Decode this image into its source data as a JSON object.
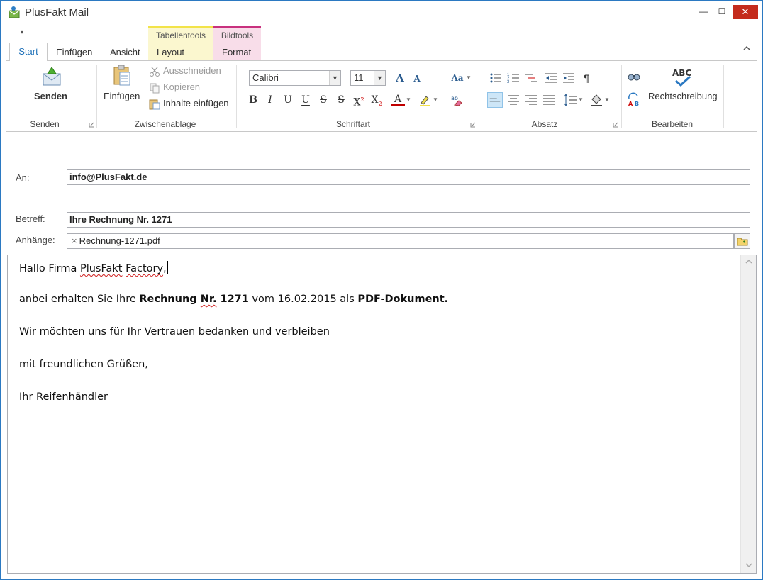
{
  "window": {
    "title": "PlusFakt Mail",
    "min_glyph": "—",
    "max_glyph": "☐",
    "close_glyph": "✕"
  },
  "qat": {
    "dropdown_glyph": "▾"
  },
  "tabs": {
    "start": "Start",
    "einfuegen": "Einfügen",
    "ansicht": "Ansicht",
    "layout": "Layout",
    "format": "Format",
    "ctx_tabellentools": "Tabellentools",
    "ctx_bildtools": "Bildtools"
  },
  "ribbon": {
    "senden": {
      "button": "Senden",
      "group": "Senden"
    },
    "zwischenablage": {
      "einfuegen": "Einfügen",
      "ausschneiden": "Ausschneiden",
      "kopieren": "Kopieren",
      "inhalte_einfuegen": "Inhalte einfügen",
      "group": "Zwischenablage"
    },
    "schriftart": {
      "font": "Calibri",
      "size": "11",
      "grow_glyph": "A",
      "shrink_glyph": "A",
      "case_glyph": "Aa",
      "bold": "B",
      "italic": "I",
      "underline": "U",
      "double_underline": "U",
      "strike": "S",
      "double_strike": "S",
      "superscript": "X",
      "subscript": "X",
      "font_color_glyph": "A",
      "group": "Schriftart"
    },
    "absatz": {
      "pilcrow": "¶",
      "group": "Absatz"
    },
    "bearbeiten": {
      "rechtschreibung": "Rechtschreibung",
      "abc": "ABC",
      "group": "Bearbeiten"
    }
  },
  "form": {
    "an_label": "An:",
    "an_value": "info@PlusFakt.de",
    "betreff_label": "Betreff:",
    "betreff_value": "Ihre Rechnung Nr. 1271",
    "anhaenge_label": "Anhänge:",
    "attachment_remove": "×",
    "attachment_name": "Rechnung-1271.pdf"
  },
  "body": {
    "l1_a": "Hallo Firma ",
    "l1_b": "PlusFakt",
    "l1_c": " ",
    "l1_d": "Factory",
    "l1_e": ",",
    "l2_a": "anbei erhalten Sie Ihre ",
    "l2_b": "Rechnung ",
    "l2_c": "Nr.",
    "l2_d": " 1271",
    "l2_e": " vom 16.02.2015 als ",
    "l2_f": "PDF-Dokument.",
    "l3": "Wir möchten uns für Ihr Vertrauen bedanken und verbleiben",
    "l4": "mit freundlichen Grüßen,",
    "l5": "Ihr Reifenhändler"
  },
  "colors": {
    "accent": "#2072b9",
    "ctx_table": "#f2e349",
    "ctx_bild": "#c8317e",
    "close": "#c42b1c",
    "spell": "#d02020"
  }
}
